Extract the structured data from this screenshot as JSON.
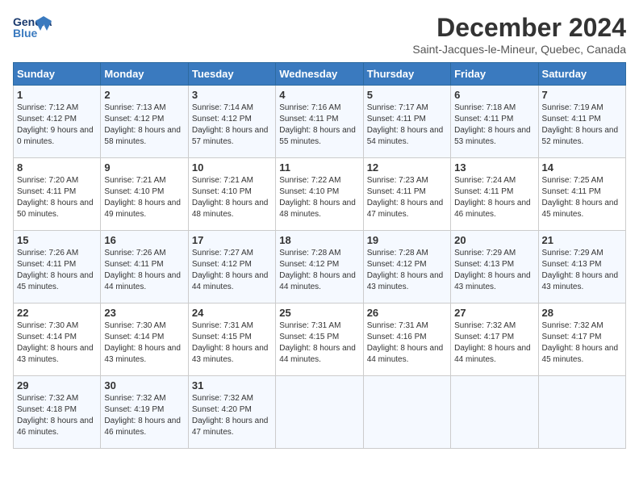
{
  "header": {
    "logo_text_general": "General",
    "logo_text_blue": "Blue",
    "month_title": "December 2024",
    "location": "Saint-Jacques-le-Mineur, Quebec, Canada"
  },
  "weekdays": [
    "Sunday",
    "Monday",
    "Tuesday",
    "Wednesday",
    "Thursday",
    "Friday",
    "Saturday"
  ],
  "weeks": [
    [
      {
        "day": "1",
        "sunrise": "7:12 AM",
        "sunset": "4:12 PM",
        "daylight": "9 hours and 0 minutes."
      },
      {
        "day": "2",
        "sunrise": "7:13 AM",
        "sunset": "4:12 PM",
        "daylight": "8 hours and 58 minutes."
      },
      {
        "day": "3",
        "sunrise": "7:14 AM",
        "sunset": "4:12 PM",
        "daylight": "8 hours and 57 minutes."
      },
      {
        "day": "4",
        "sunrise": "7:16 AM",
        "sunset": "4:11 PM",
        "daylight": "8 hours and 55 minutes."
      },
      {
        "day": "5",
        "sunrise": "7:17 AM",
        "sunset": "4:11 PM",
        "daylight": "8 hours and 54 minutes."
      },
      {
        "day": "6",
        "sunrise": "7:18 AM",
        "sunset": "4:11 PM",
        "daylight": "8 hours and 53 minutes."
      },
      {
        "day": "7",
        "sunrise": "7:19 AM",
        "sunset": "4:11 PM",
        "daylight": "8 hours and 52 minutes."
      }
    ],
    [
      {
        "day": "8",
        "sunrise": "7:20 AM",
        "sunset": "4:11 PM",
        "daylight": "8 hours and 50 minutes."
      },
      {
        "day": "9",
        "sunrise": "7:21 AM",
        "sunset": "4:10 PM",
        "daylight": "8 hours and 49 minutes."
      },
      {
        "day": "10",
        "sunrise": "7:21 AM",
        "sunset": "4:10 PM",
        "daylight": "8 hours and 48 minutes."
      },
      {
        "day": "11",
        "sunrise": "7:22 AM",
        "sunset": "4:10 PM",
        "daylight": "8 hours and 48 minutes."
      },
      {
        "day": "12",
        "sunrise": "7:23 AM",
        "sunset": "4:11 PM",
        "daylight": "8 hours and 47 minutes."
      },
      {
        "day": "13",
        "sunrise": "7:24 AM",
        "sunset": "4:11 PM",
        "daylight": "8 hours and 46 minutes."
      },
      {
        "day": "14",
        "sunrise": "7:25 AM",
        "sunset": "4:11 PM",
        "daylight": "8 hours and 45 minutes."
      }
    ],
    [
      {
        "day": "15",
        "sunrise": "7:26 AM",
        "sunset": "4:11 PM",
        "daylight": "8 hours and 45 minutes."
      },
      {
        "day": "16",
        "sunrise": "7:26 AM",
        "sunset": "4:11 PM",
        "daylight": "8 hours and 44 minutes."
      },
      {
        "day": "17",
        "sunrise": "7:27 AM",
        "sunset": "4:12 PM",
        "daylight": "8 hours and 44 minutes."
      },
      {
        "day": "18",
        "sunrise": "7:28 AM",
        "sunset": "4:12 PM",
        "daylight": "8 hours and 44 minutes."
      },
      {
        "day": "19",
        "sunrise": "7:28 AM",
        "sunset": "4:12 PM",
        "daylight": "8 hours and 43 minutes."
      },
      {
        "day": "20",
        "sunrise": "7:29 AM",
        "sunset": "4:13 PM",
        "daylight": "8 hours and 43 minutes."
      },
      {
        "day": "21",
        "sunrise": "7:29 AM",
        "sunset": "4:13 PM",
        "daylight": "8 hours and 43 minutes."
      }
    ],
    [
      {
        "day": "22",
        "sunrise": "7:30 AM",
        "sunset": "4:14 PM",
        "daylight": "8 hours and 43 minutes."
      },
      {
        "day": "23",
        "sunrise": "7:30 AM",
        "sunset": "4:14 PM",
        "daylight": "8 hours and 43 minutes."
      },
      {
        "day": "24",
        "sunrise": "7:31 AM",
        "sunset": "4:15 PM",
        "daylight": "8 hours and 43 minutes."
      },
      {
        "day": "25",
        "sunrise": "7:31 AM",
        "sunset": "4:15 PM",
        "daylight": "8 hours and 44 minutes."
      },
      {
        "day": "26",
        "sunrise": "7:31 AM",
        "sunset": "4:16 PM",
        "daylight": "8 hours and 44 minutes."
      },
      {
        "day": "27",
        "sunrise": "7:32 AM",
        "sunset": "4:17 PM",
        "daylight": "8 hours and 44 minutes."
      },
      {
        "day": "28",
        "sunrise": "7:32 AM",
        "sunset": "4:17 PM",
        "daylight": "8 hours and 45 minutes."
      }
    ],
    [
      {
        "day": "29",
        "sunrise": "7:32 AM",
        "sunset": "4:18 PM",
        "daylight": "8 hours and 46 minutes."
      },
      {
        "day": "30",
        "sunrise": "7:32 AM",
        "sunset": "4:19 PM",
        "daylight": "8 hours and 46 minutes."
      },
      {
        "day": "31",
        "sunrise": "7:32 AM",
        "sunset": "4:20 PM",
        "daylight": "8 hours and 47 minutes."
      },
      null,
      null,
      null,
      null
    ]
  ]
}
